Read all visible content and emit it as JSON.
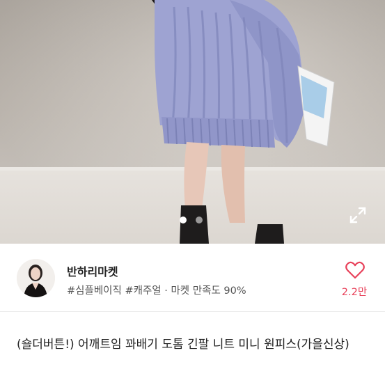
{
  "product": {
    "title": "(숄더버튼!) 어깨트임 꽈배기 도톰 긴팔 니트 미니 원피스(가을신상)",
    "image": {
      "alt": "보라색 꽈배기 니트 원피스를 입은 모델",
      "pager": {
        "current": 1,
        "total": 2
      }
    }
  },
  "seller": {
    "name": "반하리마켓",
    "tags": [
      "#심플베이직",
      "#캐주얼"
    ],
    "separator": "·",
    "satisfaction": "마켓 만족도 90%"
  },
  "like": {
    "count": "2.2만",
    "color": "#e8415a"
  },
  "icons": {
    "expand": "expand-icon",
    "heart": "heart-icon"
  }
}
